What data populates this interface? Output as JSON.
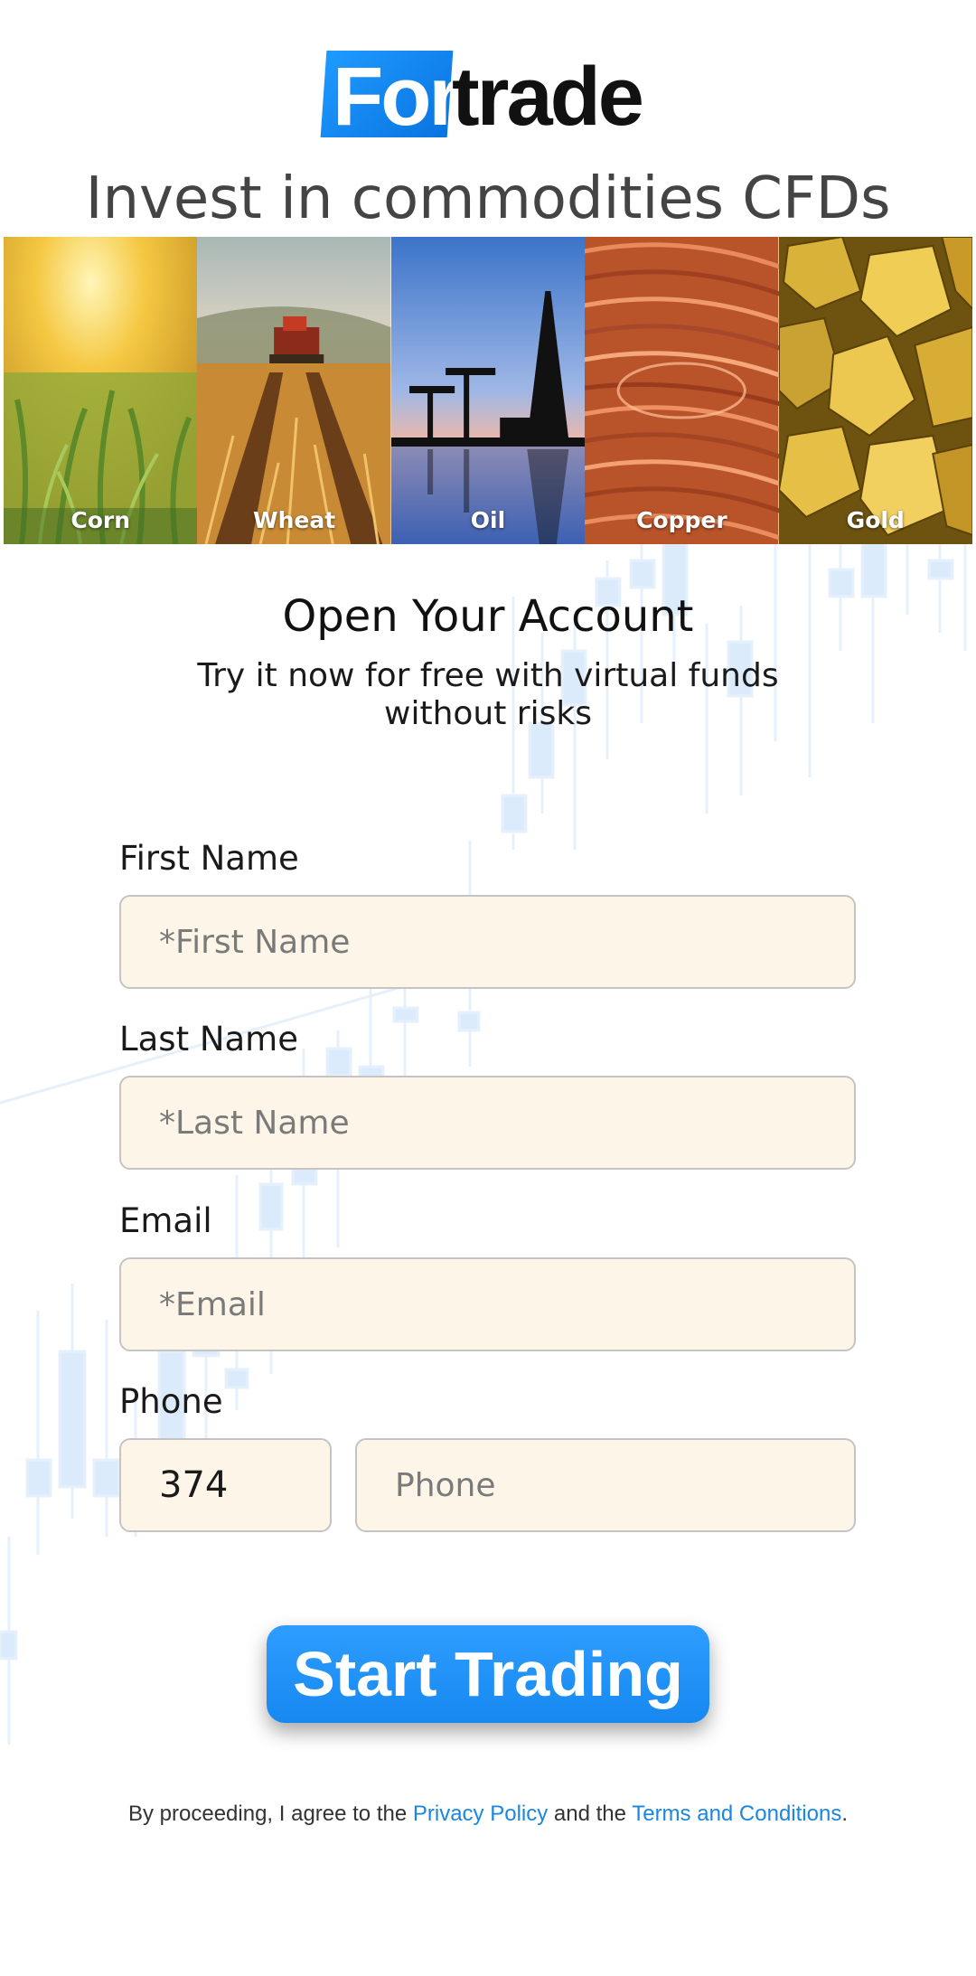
{
  "brand": {
    "logo_part1": "For",
    "logo_part2": "trade",
    "accent_color": "#1e9bff"
  },
  "headline": "Invest in commodities CFDs",
  "commodities": [
    {
      "label": "Corn"
    },
    {
      "label": "Wheat"
    },
    {
      "label": "Oil"
    },
    {
      "label": "Copper"
    },
    {
      "label": "Gold"
    }
  ],
  "form": {
    "title": "Open Your Account",
    "subtitle": "Try it now for free with virtual funds without risks",
    "first_name": {
      "label": "First Name",
      "placeholder": "*First Name",
      "value": ""
    },
    "last_name": {
      "label": "Last Name",
      "placeholder": "*Last Name",
      "value": ""
    },
    "email": {
      "label": "Email",
      "placeholder": "*Email",
      "value": ""
    },
    "phone": {
      "label": "Phone",
      "code_value": "374",
      "placeholder": "Phone",
      "value": ""
    },
    "submit_label": "Start Trading"
  },
  "legal": {
    "prefix": "By proceeding, I agree to the ",
    "privacy_link": "Privacy Policy",
    "middle": " and the ",
    "terms_link": "Terms and Conditions",
    "suffix": "."
  }
}
